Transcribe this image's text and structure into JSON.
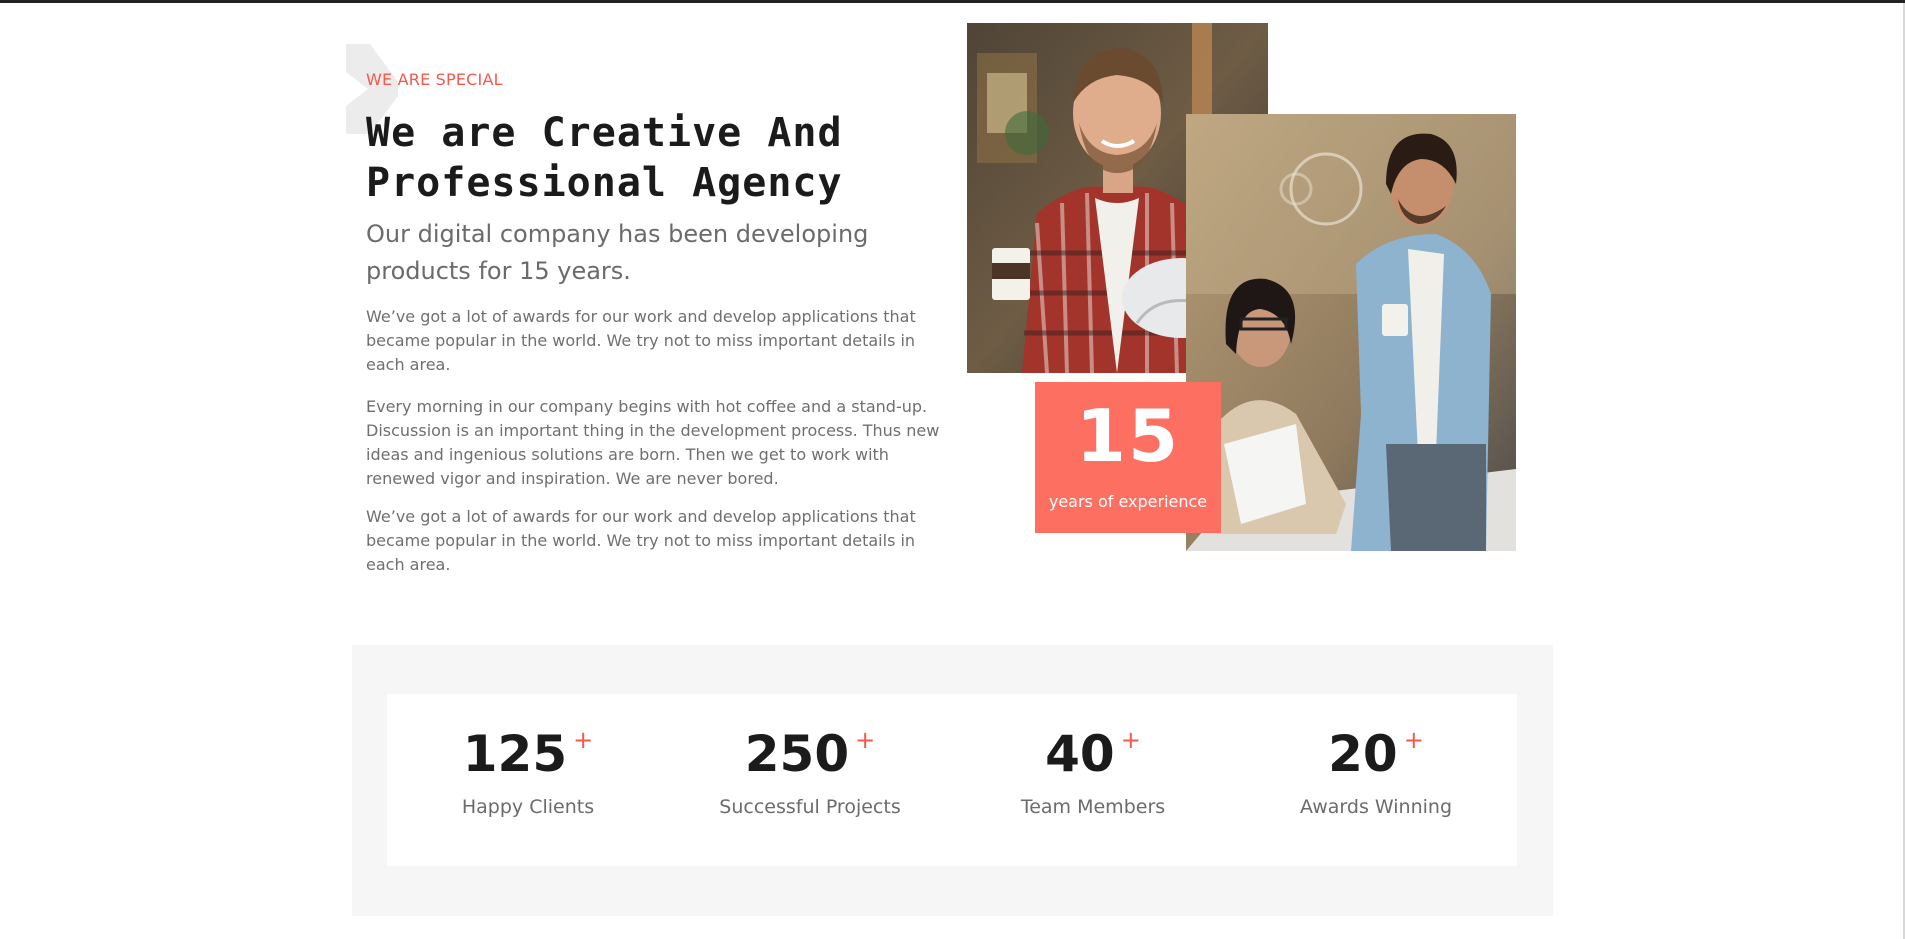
{
  "about": {
    "eyebrow": "WE ARE SPECIAL",
    "headline": "We are Creative And Professional Agency",
    "lead": "Our digital company has been developing products for 15 years.",
    "paragraphs": [
      "We’ve got a lot of awards for our work and develop applications that became popular in the world. We try not to miss important details in each area.",
      "Every morning in our company begins with hot coffee and a stand-up. Discussion is an important thing in the development process. Thus new ideas and ingenious solutions are born. Then we get to work with renewed vigor and inspiration. We are never bored.",
      "We’ve got a lot of awards for our work and develop applications that became popular in the world. We try not to miss important details in each area."
    ]
  },
  "experience": {
    "number": "15",
    "label": "years of experience"
  },
  "stats": [
    {
      "number": "125",
      "suffix": "+",
      "label": "Happy Clients"
    },
    {
      "number": "250",
      "suffix": "+",
      "label": "Successful Projects"
    },
    {
      "number": "40",
      "suffix": "+",
      "label": "Team Members"
    },
    {
      "number": "20",
      "suffix": "+",
      "label": "Awards Winning"
    }
  ],
  "colors": {
    "accent": "#f4594b",
    "badge": "#fd6f61",
    "heading": "#1b1b1b",
    "body_text": "#6f6f6f",
    "stats_background": "#f6f6f6"
  },
  "images": [
    {
      "icon": "photo-man-holding-coffee-and-blueprints"
    },
    {
      "icon": "photo-team-meeting-with-coffee"
    }
  ]
}
